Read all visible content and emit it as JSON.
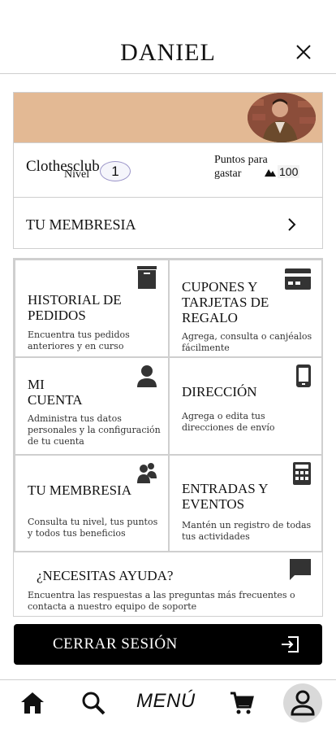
{
  "header": {
    "title": "DANIEL",
    "close_icon": "close-icon"
  },
  "profile": {
    "brand": "Clothesclub",
    "level_label": "Nivel",
    "level_value": "1",
    "points_label": "Puntos para gastar",
    "points_value": "100",
    "membership_label": "TU MEMBRESIA"
  },
  "tiles": [
    {
      "title": "HISTORIAL DE PEDIDOS",
      "description": "Encuentra tus pedidos anteriores y en curso",
      "icon": "box-icon"
    },
    {
      "title": "CUPONES Y TARJETAS DE REGALO",
      "description": "Agrega, consulta o canjéalos fácilmente",
      "icon": "card-icon"
    },
    {
      "title": "MI CUENTA",
      "description": "Administra tus datos personales y la configuración de tu cuenta",
      "icon": "person-icon"
    },
    {
      "title": "DIRECCIÓN",
      "description": "Agrega o edita tus direcciones de envío",
      "icon": "phone-icon"
    },
    {
      "title": "TU MEMBRESIA",
      "description": "Consulta tu nivel, tus puntos y todos tus beneficios",
      "icon": "people-icon"
    },
    {
      "title": "ENTRADAS Y EVENTOS",
      "description": "Mantén un registro de todas tus actividades",
      "icon": "calculator-icon"
    }
  ],
  "help": {
    "title": "¿NECESITAS AYUDA?",
    "description": "Encuentra las respuestas a las preguntas más frecuentes o contacta a nuestro equipo de soporte"
  },
  "logout": {
    "label": "CERRAR SESIÓN"
  },
  "tabbar": {
    "menu_label": "MENÚ"
  },
  "colors": {
    "banner": "#e3b994",
    "button_bg": "#000000",
    "active_tab": "#d9d9d9"
  }
}
